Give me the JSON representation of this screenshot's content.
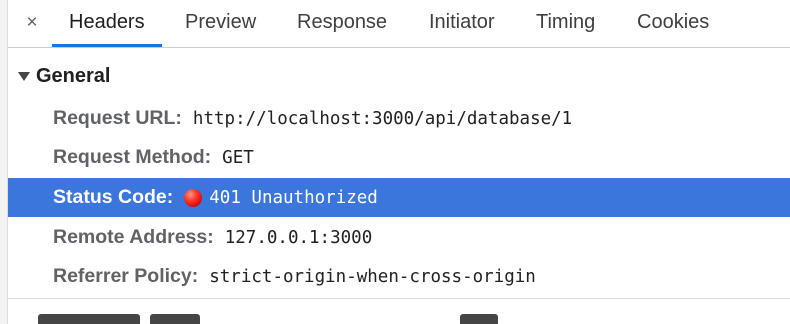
{
  "tabs": {
    "close_icon": "×",
    "items": [
      {
        "label": "Headers",
        "active": true
      },
      {
        "label": "Preview",
        "active": false
      },
      {
        "label": "Response",
        "active": false
      },
      {
        "label": "Initiator",
        "active": false
      },
      {
        "label": "Timing",
        "active": false
      },
      {
        "label": "Cookies",
        "active": false
      }
    ]
  },
  "general": {
    "title": "General",
    "rows": [
      {
        "key": "Request URL:",
        "value": "http://localhost:3000/api/database/1"
      },
      {
        "key": "Request Method:",
        "value": "GET"
      },
      {
        "key": "Status Code:",
        "value": "401 Unauthorized"
      },
      {
        "key": "Remote Address:",
        "value": "127.0.0.1:3000"
      },
      {
        "key": "Referrer Policy:",
        "value": "strict-origin-when-cross-origin"
      }
    ]
  },
  "colors": {
    "selected_row": "#3b76dd",
    "active_tab_underline": "#1a73e8",
    "status_dot": "#ff3b30"
  }
}
